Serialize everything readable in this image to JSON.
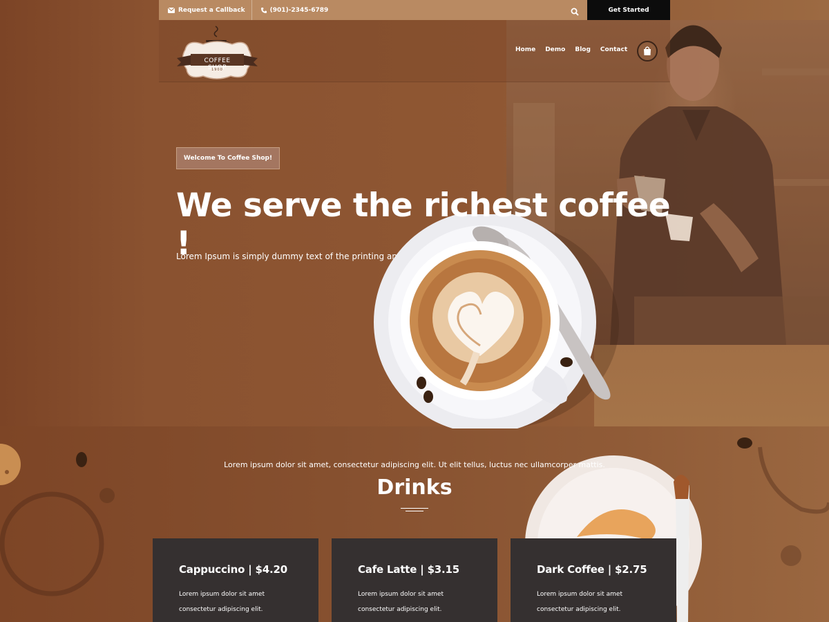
{
  "topbar": {
    "callback_label": "Request a Callback",
    "phone": "(901)-2345-6789",
    "cta_label": "Get Started"
  },
  "brand": {
    "name": "COFFEE SHOP",
    "since": "1900"
  },
  "nav": {
    "items": [
      "Home",
      "Demo",
      "Blog",
      "Contact"
    ]
  },
  "hero": {
    "badge": "Welcome To Coffee Shop!",
    "title": "We serve the richest coffee !",
    "text": "Lorem Ipsum is simply dummy text of the printing and typesetting industry."
  },
  "drinks": {
    "subtitle": "Lorem ipsum dolor sit amet, consectetur adipiscing elit. Ut elit tellus, luctus nec ullamcorper mattis.",
    "title": "Drinks",
    "cards": [
      {
        "name": "Cappuccino | $4.20",
        "line1": "Lorem ipsum dolor sit amet",
        "line2": "consectetur adipiscing elit."
      },
      {
        "name": "Cafe Latte | $3.15",
        "line1": "Lorem ipsum dolor sit amet",
        "line2": "consectetur adipiscing elit."
      },
      {
        "name": "Dark Coffee | $2.75",
        "line1": "Lorem ipsum dolor sit amet",
        "line2": "consectetur adipiscing elit."
      }
    ]
  },
  "colors": {
    "topbar": "#b98a62",
    "cta": "#0c0c0c",
    "card": "#353030",
    "badge": "#a47660"
  },
  "icons": [
    "envelope-icon",
    "phone-icon",
    "search-icon",
    "shopping-bag-icon"
  ]
}
